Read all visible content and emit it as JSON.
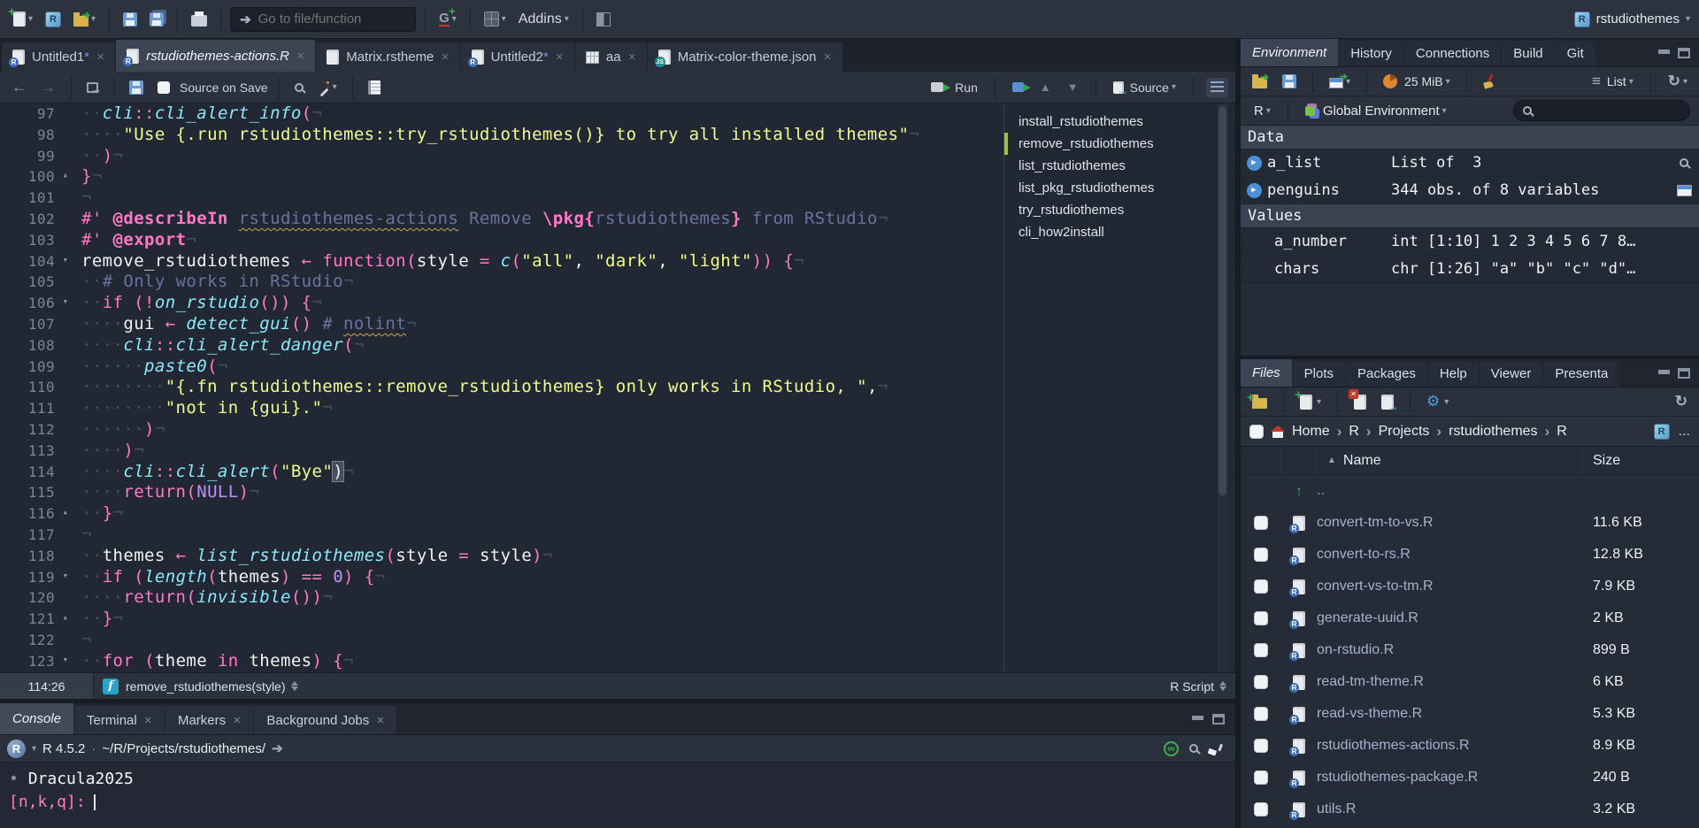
{
  "icons": {
    "close": "✕",
    "caret": "▾",
    "chevron": "›",
    "sort_asc": "▲",
    "fold_down": "▾",
    "fold_up": "▴",
    "play": "▶",
    "back": "←",
    "forward": "→",
    "up": "▲",
    "down": "▼",
    "infinity": "∞",
    "gear": "⚙",
    "refresh": "↻",
    "lines": "≡",
    "up_dir": "↑",
    "goto_dir": "➔",
    "bullet": "•",
    "r_letter": "R",
    "f_letter": "f"
  },
  "topbar": {
    "goto_placeholder": "Go to file/function",
    "addins_label": "Addins",
    "project_name": "rstudiothemes"
  },
  "editor": {
    "dirty_mark": "*",
    "tabs": [
      {
        "label": "Untitled1",
        "icon": "r-doc",
        "dirty": true,
        "active": false
      },
      {
        "label": "rstudiothemes-actions.R",
        "icon": "r-doc",
        "dirty": false,
        "active": true
      },
      {
        "label": "Matrix.rstheme",
        "icon": "file",
        "dirty": false,
        "active": false
      },
      {
        "label": "Untitled2",
        "icon": "r-doc",
        "dirty": true,
        "active": false
      },
      {
        "label": "aa",
        "icon": "grid",
        "dirty": false,
        "active": false
      },
      {
        "label": "Matrix-color-theme.json",
        "icon": "js",
        "dirty": false,
        "active": false
      }
    ],
    "toolbar": {
      "source_on_save": "Source on Save",
      "run_label": "Run",
      "source_label": "Source"
    },
    "status": {
      "position": "114:26",
      "context": "remove_rstudiothemes(style)",
      "doc_type": "R Script"
    },
    "code": {
      "lines": [
        {
          "n": 97,
          "tk": [
            [
              "w",
              "··"
            ],
            [
              "f",
              "cli"
            ],
            [
              "k",
              "::"
            ],
            [
              "f",
              "cli_alert_info"
            ],
            [
              "k",
              "("
            ],
            [
              "w",
              "¬"
            ]
          ]
        },
        {
          "n": 98,
          "tk": [
            [
              "w",
              "····"
            ],
            [
              "s",
              "\"Use {.run rstudiothemes::try_rstudiothemes()} to try all installed themes\""
            ],
            [
              "w",
              "¬"
            ]
          ]
        },
        {
          "n": 99,
          "tk": [
            [
              "w",
              "··"
            ],
            [
              "k",
              ")"
            ],
            [
              "w",
              "¬"
            ]
          ]
        },
        {
          "n": 100,
          "fold": "up",
          "tk": [
            [
              "k",
              "}"
            ],
            [
              "w",
              "¬"
            ]
          ]
        },
        {
          "n": 101,
          "tk": [
            [
              "w",
              "¬"
            ]
          ]
        },
        {
          "n": 102,
          "tk": [
            [
              "k",
              "#'"
            ],
            [
              "c",
              " "
            ],
            [
              "a",
              "@describeIn"
            ],
            [
              "c",
              " "
            ],
            [
              "u",
              "rstudiothemes-actions"
            ],
            [
              "c",
              " Remove "
            ],
            [
              "a",
              "\\pkg{"
            ],
            [
              "c",
              "rstudiothemes"
            ],
            [
              "a",
              "}"
            ],
            [
              "c",
              " from RStudio"
            ],
            [
              "w",
              "¬"
            ]
          ]
        },
        {
          "n": 103,
          "tk": [
            [
              "k",
              "#'"
            ],
            [
              "c",
              " "
            ],
            [
              "a",
              "@export"
            ],
            [
              "w",
              "¬"
            ]
          ]
        },
        {
          "n": 104,
          "fold": "down",
          "tk": [
            [
              "g",
              "remove_rstudiothemes"
            ],
            [
              "k",
              " ← "
            ],
            [
              "k",
              "function"
            ],
            [
              "k",
              "("
            ],
            [
              "g",
              "style"
            ],
            [
              "k",
              " = "
            ],
            [
              "f",
              "c"
            ],
            [
              "k",
              "("
            ],
            [
              "s",
              "\"all\""
            ],
            [
              "g",
              ", "
            ],
            [
              "s",
              "\"dark\""
            ],
            [
              "g",
              ", "
            ],
            [
              "s",
              "\"light\""
            ],
            [
              "k",
              "))"
            ],
            [
              "g",
              " "
            ],
            [
              "k",
              "{"
            ],
            [
              "w",
              "¬"
            ]
          ]
        },
        {
          "n": 105,
          "tk": [
            [
              "w",
              "··"
            ],
            [
              "c",
              "# Only works in RStudio"
            ],
            [
              "w",
              "¬"
            ]
          ]
        },
        {
          "n": 106,
          "fold": "down",
          "tk": [
            [
              "w",
              "··"
            ],
            [
              "k",
              "if"
            ],
            [
              "g",
              " "
            ],
            [
              "k",
              "(!"
            ],
            [
              "f",
              "on_rstudio"
            ],
            [
              "k",
              "())"
            ],
            [
              "g",
              " "
            ],
            [
              "k",
              "{"
            ],
            [
              "w",
              "¬"
            ]
          ]
        },
        {
          "n": 107,
          "tk": [
            [
              "w",
              "····"
            ],
            [
              "g",
              "gui"
            ],
            [
              "k",
              " ← "
            ],
            [
              "f",
              "detect_gui"
            ],
            [
              "k",
              "()"
            ],
            [
              "g",
              " "
            ],
            [
              "c",
              "# "
            ],
            [
              "u",
              "nolint"
            ],
            [
              "w",
              "¬"
            ]
          ]
        },
        {
          "n": 108,
          "tk": [
            [
              "w",
              "····"
            ],
            [
              "f",
              "cli"
            ],
            [
              "k",
              "::"
            ],
            [
              "f",
              "cli_alert_danger"
            ],
            [
              "k",
              "("
            ],
            [
              "w",
              "¬"
            ]
          ]
        },
        {
          "n": 109,
          "tk": [
            [
              "w",
              "······"
            ],
            [
              "f",
              "paste0"
            ],
            [
              "k",
              "("
            ],
            [
              "w",
              "¬"
            ]
          ]
        },
        {
          "n": 110,
          "tk": [
            [
              "w",
              "········"
            ],
            [
              "s",
              "\"{.fn rstudiothemes::remove_rstudiothemes} only works in RStudio, \""
            ],
            [
              "g",
              ","
            ],
            [
              "w",
              "¬"
            ]
          ]
        },
        {
          "n": 111,
          "tk": [
            [
              "w",
              "········"
            ],
            [
              "s",
              "\"not in {gui}.\""
            ],
            [
              "w",
              "¬"
            ]
          ]
        },
        {
          "n": 112,
          "tk": [
            [
              "w",
              "······"
            ],
            [
              "k",
              ")"
            ],
            [
              "w",
              "¬"
            ]
          ]
        },
        {
          "n": 113,
          "tk": [
            [
              "w",
              "····"
            ],
            [
              "k",
              ")"
            ],
            [
              "w",
              "¬"
            ]
          ]
        },
        {
          "n": 114,
          "tk": [
            [
              "w",
              "····"
            ],
            [
              "f",
              "cli"
            ],
            [
              "k",
              "::"
            ],
            [
              "f",
              "cli_alert"
            ],
            [
              "k",
              "("
            ],
            [
              "s",
              "\"Bye\""
            ],
            [
              "h",
              ")"
            ],
            [
              "w",
              "¬"
            ]
          ]
        },
        {
          "n": 115,
          "tk": [
            [
              "w",
              "····"
            ],
            [
              "k",
              "return"
            ],
            [
              "k",
              "("
            ],
            [
              "m",
              "NULL"
            ],
            [
              "k",
              ")"
            ],
            [
              "w",
              "¬"
            ]
          ]
        },
        {
          "n": 116,
          "fold": "up",
          "tk": [
            [
              "w",
              "··"
            ],
            [
              "k",
              "}"
            ],
            [
              "w",
              "¬"
            ]
          ]
        },
        {
          "n": 117,
          "tk": [
            [
              "w",
              "¬"
            ]
          ]
        },
        {
          "n": 118,
          "tk": [
            [
              "w",
              "··"
            ],
            [
              "g",
              "themes"
            ],
            [
              "k",
              " ← "
            ],
            [
              "f",
              "list_rstudiothemes"
            ],
            [
              "k",
              "("
            ],
            [
              "g",
              "style"
            ],
            [
              "k",
              " = "
            ],
            [
              "g",
              "style"
            ],
            [
              "k",
              ")"
            ],
            [
              "w",
              "¬"
            ]
          ]
        },
        {
          "n": 119,
          "fold": "down",
          "tk": [
            [
              "w",
              "··"
            ],
            [
              "k",
              "if"
            ],
            [
              "g",
              " "
            ],
            [
              "k",
              "("
            ],
            [
              "f",
              "length"
            ],
            [
              "k",
              "("
            ],
            [
              "g",
              "themes"
            ],
            [
              "k",
              ") == "
            ],
            [
              "m",
              "0"
            ],
            [
              "k",
              ")"
            ],
            [
              "g",
              " "
            ],
            [
              "k",
              "{"
            ],
            [
              "w",
              "¬"
            ]
          ]
        },
        {
          "n": 120,
          "tk": [
            [
              "w",
              "····"
            ],
            [
              "k",
              "return"
            ],
            [
              "k",
              "("
            ],
            [
              "f",
              "invisible"
            ],
            [
              "k",
              "())"
            ],
            [
              "w",
              "¬"
            ]
          ]
        },
        {
          "n": 121,
          "fold": "up",
          "tk": [
            [
              "w",
              "··"
            ],
            [
              "k",
              "}"
            ],
            [
              "w",
              "¬"
            ]
          ]
        },
        {
          "n": 122,
          "tk": [
            [
              "w",
              "¬"
            ]
          ]
        },
        {
          "n": 123,
          "fold": "down",
          "tk": [
            [
              "w",
              "··"
            ],
            [
              "k",
              "for"
            ],
            [
              "g",
              " "
            ],
            [
              "k",
              "("
            ],
            [
              "g",
              "theme"
            ],
            [
              "k",
              " in "
            ],
            [
              "g",
              "themes"
            ],
            [
              "k",
              ")"
            ],
            [
              "g",
              " "
            ],
            [
              "k",
              "{"
            ],
            [
              "w",
              "¬"
            ]
          ]
        }
      ]
    }
  },
  "outline": {
    "active_index": 1,
    "items": [
      "install_rstudiothemes",
      "remove_rstudiothemes",
      "list_rstudiothemes",
      "list_pkg_rstudiothemes",
      "try_rstudiothemes",
      "cli_how2install"
    ]
  },
  "console": {
    "tabs": [
      {
        "label": "Console",
        "active": true,
        "closable": false
      },
      {
        "label": "Terminal",
        "active": false,
        "closable": true
      },
      {
        "label": "Markers",
        "active": false,
        "closable": true
      },
      {
        "label": "Background Jobs",
        "active": false,
        "closable": true
      }
    ],
    "info": {
      "version": "R 4.5.2",
      "separator": "·",
      "path": "~/R/Projects/rstudiothemes/"
    },
    "output_line": {
      "bullet": "•",
      "text": "Dracula2025"
    },
    "prompt": "[n,k,q]:"
  },
  "environment": {
    "tabs": [
      {
        "label": "Environment",
        "active": true
      },
      {
        "label": "History",
        "active": false
      },
      {
        "label": "Connections",
        "active": false
      },
      {
        "label": "Build",
        "active": false
      },
      {
        "label": "Git",
        "active": false
      }
    ],
    "memory": "25 MiB",
    "view_label": "List",
    "language": "R",
    "env_name": "Global Environment",
    "sections": [
      {
        "title": "Data",
        "rows": [
          {
            "name": "a_list",
            "value": "List of  3",
            "expandable": true,
            "action": "search"
          },
          {
            "name": "penguins",
            "value": "344 obs. of 8 variables",
            "expandable": true,
            "action": "table"
          }
        ]
      },
      {
        "title": "Values",
        "rows": [
          {
            "name": "a_number",
            "value": "int [1:10] 1 2 3 4 5 6 7 8…",
            "expandable": false,
            "action": null
          },
          {
            "name": "chars",
            "value": "chr [1:26] \"a\" \"b\" \"c\" \"d\"…",
            "expandable": false,
            "action": null
          }
        ]
      }
    ]
  },
  "files": {
    "tabs": [
      {
        "label": "Files",
        "active": true
      },
      {
        "label": "Plots",
        "active": false
      },
      {
        "label": "Packages",
        "active": false
      },
      {
        "label": "Help",
        "active": false
      },
      {
        "label": "Viewer",
        "active": false
      },
      {
        "label": "Presenta",
        "active": false
      }
    ],
    "breadcrumb": [
      "Home",
      "R",
      "Projects",
      "rstudiothemes",
      "R"
    ],
    "more_label": "...",
    "columns": {
      "name": "Name",
      "size": "Size"
    },
    "rows": [
      {
        "name": "..",
        "size": "",
        "up": true
      },
      {
        "name": "convert-tm-to-vs.R",
        "size": "11.6 KB",
        "up": false
      },
      {
        "name": "convert-to-rs.R",
        "size": "12.8 KB",
        "up": false
      },
      {
        "name": "convert-vs-to-tm.R",
        "size": "7.9 KB",
        "up": false
      },
      {
        "name": "generate-uuid.R",
        "size": "2 KB",
        "up": false
      },
      {
        "name": "on-rstudio.R",
        "size": "899 B",
        "up": false
      },
      {
        "name": "read-tm-theme.R",
        "size": "6 KB",
        "up": false
      },
      {
        "name": "read-vs-theme.R",
        "size": "5.3 KB",
        "up": false
      },
      {
        "name": "rstudiothemes-actions.R",
        "size": "8.9 KB",
        "up": false
      },
      {
        "name": "rstudiothemes-package.R",
        "size": "240 B",
        "up": false
      },
      {
        "name": "utils.R",
        "size": "3.2 KB",
        "up": false
      }
    ]
  }
}
